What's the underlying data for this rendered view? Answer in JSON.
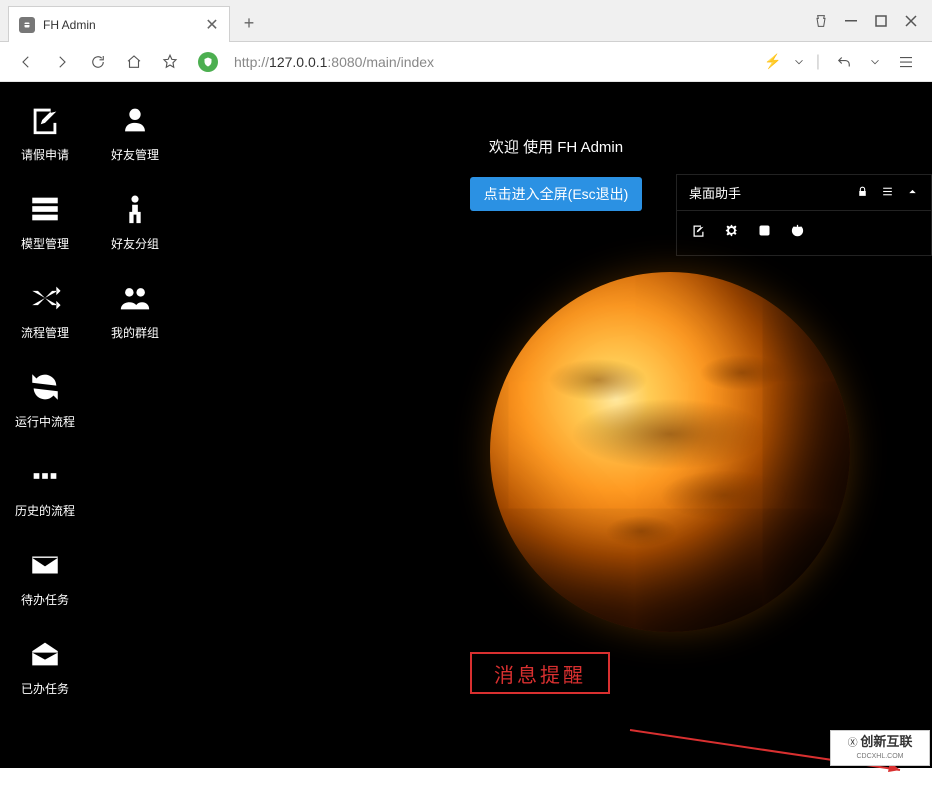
{
  "browser": {
    "tab_title": "FH Admin",
    "url_prefix": "http://",
    "url_host": "127.0.0.1",
    "url_port": ":8080",
    "url_path": "/main/index"
  },
  "sidebar": {
    "items": [
      {
        "label": "请假申请",
        "icon": "edit"
      },
      {
        "label": "好友管理",
        "icon": "user"
      },
      {
        "label": "模型管理",
        "icon": "stack"
      },
      {
        "label": "好友分组",
        "icon": "person"
      },
      {
        "label": "流程管理",
        "icon": "shuffle"
      },
      {
        "label": "我的群组",
        "icon": "users"
      },
      {
        "label": "运行中流程",
        "icon": "refresh"
      },
      {
        "label": "历史的流程",
        "icon": "dots"
      },
      {
        "label": "待办任务",
        "icon": "envelope"
      },
      {
        "label": "已办任务",
        "icon": "envelope-open"
      }
    ]
  },
  "main": {
    "welcome_text": "欢迎 使用 FH Admin",
    "fullscreen_btn": "点击进入全屏(Esc退出)"
  },
  "assistant": {
    "title": "桌面助手"
  },
  "alert": {
    "text": "消息提醒"
  },
  "watermark": {
    "brand": "创新互联",
    "sub": "CDCXHL.COM"
  }
}
